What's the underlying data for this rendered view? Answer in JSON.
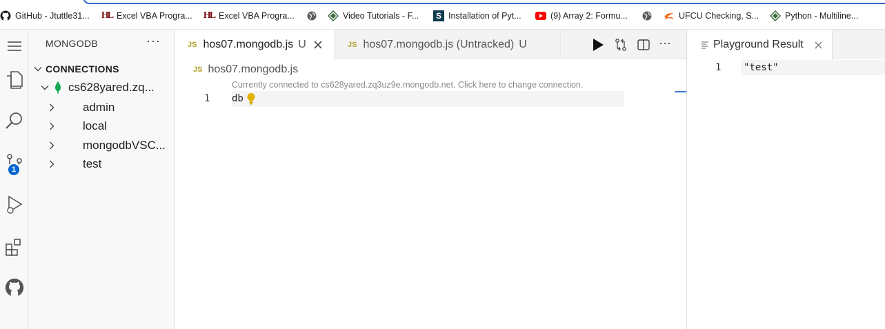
{
  "bookmarks": [
    {
      "label": "GitHub - Jtuttle31...",
      "icon": "github-icon"
    },
    {
      "label": "Excel VBA Progra...",
      "icon": "hl-icon"
    },
    {
      "label": "Excel VBA Progra...",
      "icon": "hl-icon"
    },
    {
      "label": "",
      "icon": "globe-icon"
    },
    {
      "label": "Video Tutorials - F...",
      "icon": "diamond-icon"
    },
    {
      "label": "Installation of Pyt...",
      "icon": "s-icon"
    },
    {
      "label": "(9) Array 2: Formu...",
      "icon": "youtube-icon"
    },
    {
      "label": "",
      "icon": "globe-icon"
    },
    {
      "label": "UFCU Checking, S...",
      "icon": "ufcu-icon"
    },
    {
      "label": "Python - Multiline...",
      "icon": "diamond-icon"
    }
  ],
  "activity_bar": {
    "items": [
      "menu-icon",
      "explorer-icon",
      "search-icon",
      "source-control-icon",
      "run-debug-icon",
      "extensions-icon",
      "github-icon"
    ],
    "badge": "1"
  },
  "sidebar": {
    "title": "MONGODB",
    "more": "···",
    "section": "CONNECTIONS",
    "connection": "cs628yared.zq...",
    "databases": [
      "admin",
      "local",
      "mongodbVSC...",
      "test"
    ]
  },
  "tabs": [
    {
      "label": "hos07.mongodb.js",
      "status": "U",
      "active": true
    },
    {
      "label": "hos07.mongodb.js (Untracked)",
      "status": "U",
      "active": false
    }
  ],
  "tab_more": "···",
  "editor": {
    "breadcrumb": "hos07.mongodb.js",
    "codelens": "Currently connected to cs628yared.zq3uz9e.mongodb.net. Click here to change connection.",
    "lines": [
      {
        "num": "1",
        "code": "db"
      }
    ]
  },
  "result": {
    "tab_label": "Playground Result",
    "lines": [
      {
        "num": "1",
        "code": "\"test\""
      }
    ]
  },
  "colors": {
    "accent": "#0065d0",
    "js_icon": "#b4a22d",
    "mongo_leaf": "#13aa52",
    "bulb": "#e2b203"
  }
}
